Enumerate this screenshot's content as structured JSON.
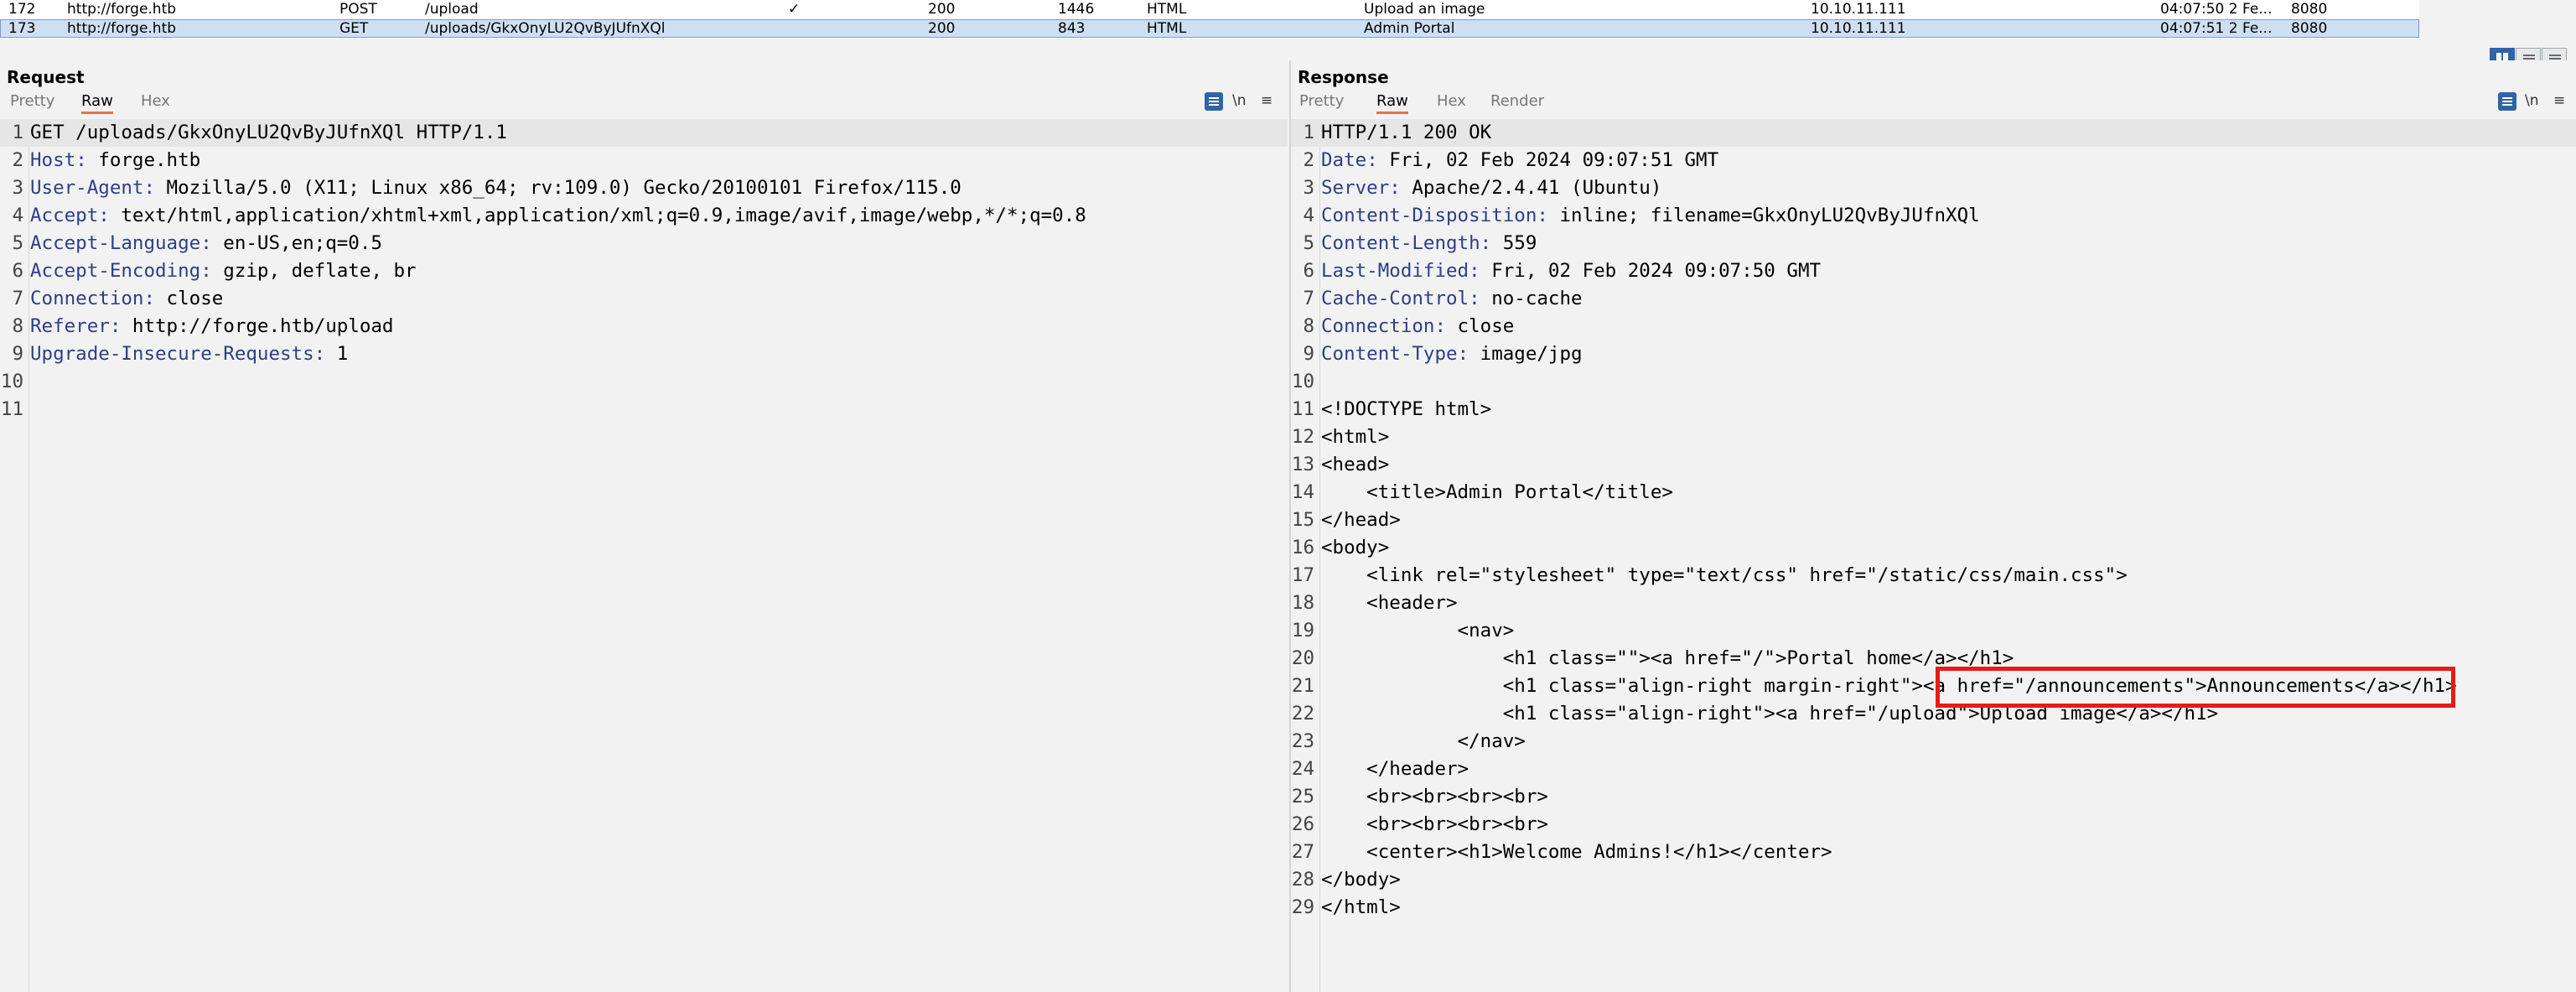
{
  "history": {
    "rows": [
      {
        "num": "172",
        "host": "http://forge.htb",
        "method": "POST",
        "url": "/upload",
        "check": "✓",
        "status": "200",
        "length": "1446",
        "mime": "HTML",
        "title": "Upload an image",
        "ip": "10.10.11.111",
        "time": "04:07:50 2 Fe...",
        "port": "8080"
      },
      {
        "num": "173",
        "host": "http://forge.htb",
        "method": "GET",
        "url": "/uploads/GkxOnyLU2QvByJUfnXQl",
        "check": "",
        "status": "200",
        "length": "843",
        "mime": "HTML",
        "title": "Admin Portal",
        "ip": "10.10.11.111",
        "time": "04:07:51 2 Fe...",
        "port": "8080"
      }
    ]
  },
  "request": {
    "title": "Request",
    "tabs": [
      "Pretty",
      "Raw",
      "Hex"
    ],
    "newline_label": "\\n",
    "menu_glyph": "≡",
    "lines": [
      {
        "n": "1",
        "k": "",
        "v": "GET /uploads/GkxOnyLU2QvByJUfnXQl HTTP/1.1"
      },
      {
        "n": "2",
        "k": "Host",
        "v": " forge.htb"
      },
      {
        "n": "3",
        "k": "User-Agent",
        "v": " Mozilla/5.0 (X11; Linux x86_64; rv:109.0) Gecko/20100101 Firefox/115.0"
      },
      {
        "n": "4",
        "k": "Accept",
        "v": " text/html,application/xhtml+xml,application/xml;q=0.9,image/avif,image/webp,*/*;q=0.8"
      },
      {
        "n": "5",
        "k": "Accept-Language",
        "v": " en-US,en;q=0.5"
      },
      {
        "n": "6",
        "k": "Accept-Encoding",
        "v": " gzip, deflate, br"
      },
      {
        "n": "7",
        "k": "Connection",
        "v": " close"
      },
      {
        "n": "8",
        "k": "Referer",
        "v": " http://forge.htb/upload"
      },
      {
        "n": "9",
        "k": "Upgrade-Insecure-Requests",
        "v": " 1"
      },
      {
        "n": "10",
        "k": "",
        "v": ""
      },
      {
        "n": "11",
        "k": "",
        "v": ""
      }
    ]
  },
  "response": {
    "title": "Response",
    "tabs": [
      "Pretty",
      "Raw",
      "Hex",
      "Render"
    ],
    "newline_label": "\\n",
    "menu_glyph": "≡",
    "lines": [
      {
        "n": "1",
        "k": "",
        "v": "HTTP/1.1 200 OK"
      },
      {
        "n": "2",
        "k": "Date",
        "v": " Fri, 02 Feb 2024 09:07:51 GMT"
      },
      {
        "n": "3",
        "k": "Server",
        "v": " Apache/2.4.41 (Ubuntu)"
      },
      {
        "n": "4",
        "k": "Content-Disposition",
        "v": " inline; filename=GkxOnyLU2QvByJUfnXQl"
      },
      {
        "n": "5",
        "k": "Content-Length",
        "v": " 559"
      },
      {
        "n": "6",
        "k": "Last-Modified",
        "v": " Fri, 02 Feb 2024 09:07:50 GMT"
      },
      {
        "n": "7",
        "k": "Cache-Control",
        "v": " no-cache"
      },
      {
        "n": "8",
        "k": "Connection",
        "v": " close"
      },
      {
        "n": "9",
        "k": "Content-Type",
        "v": " image/jpg"
      },
      {
        "n": "10",
        "k": "",
        "v": ""
      },
      {
        "n": "11",
        "k": "",
        "v": "<!DOCTYPE html>"
      },
      {
        "n": "12",
        "k": "",
        "v": "<html>"
      },
      {
        "n": "13",
        "k": "",
        "v": "<head>"
      },
      {
        "n": "14",
        "k": "",
        "v": "    <title>Admin Portal</title>"
      },
      {
        "n": "15",
        "k": "",
        "v": "</head>"
      },
      {
        "n": "16",
        "k": "",
        "v": "<body>"
      },
      {
        "n": "17",
        "k": "",
        "v": "    <link rel=\"stylesheet\" type=\"text/css\" href=\"/static/css/main.css\">"
      },
      {
        "n": "18",
        "k": "",
        "v": "    <header>"
      },
      {
        "n": "19",
        "k": "",
        "v": "            <nav>"
      },
      {
        "n": "20",
        "k": "",
        "v": "                <h1 class=\"\"><a href=\"/\">Portal home</a></h1>"
      },
      {
        "n": "21",
        "k": "",
        "v": "                <h1 class=\"align-right margin-right\"><a href=\"/announcements\">Announcements</a></h1>"
      },
      {
        "n": "22",
        "k": "",
        "v": "                <h1 class=\"align-right\"><a href=\"/upload\">Upload image</a></h1>"
      },
      {
        "n": "23",
        "k": "",
        "v": "            </nav>"
      },
      {
        "n": "24",
        "k": "",
        "v": "    </header>"
      },
      {
        "n": "25",
        "k": "",
        "v": "    <br><br><br><br>"
      },
      {
        "n": "26",
        "k": "",
        "v": "    <br><br><br><br>"
      },
      {
        "n": "27",
        "k": "",
        "v": "    <center><h1>Welcome Admins!</h1></center>"
      },
      {
        "n": "28",
        "k": "",
        "v": "</body>"
      },
      {
        "n": "29",
        "k": "",
        "v": "</html>"
      }
    ],
    "highlight_line": "21"
  },
  "colors": {
    "header_key": "#2d3f87",
    "accent_tab": "#e8743b",
    "selected_row": "#cfdff2",
    "highlight_box": "#e41c1c"
  }
}
